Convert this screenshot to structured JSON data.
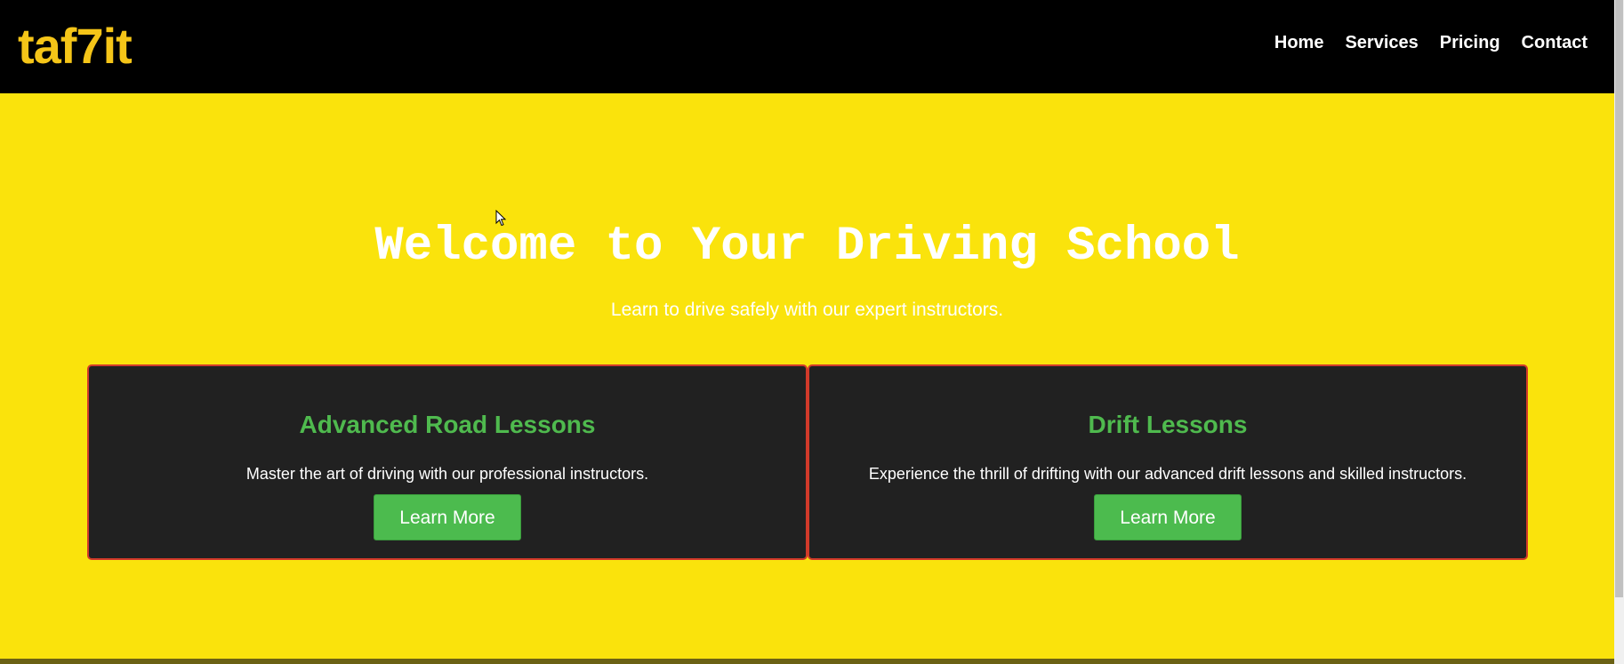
{
  "header": {
    "logo": "taf7it",
    "nav": [
      "Home",
      "Services",
      "Pricing",
      "Contact"
    ]
  },
  "hero": {
    "title": "Welcome to Your Driving School",
    "subtitle": "Learn to drive safely with our expert instructors."
  },
  "cards": [
    {
      "title": "Advanced Road Lessons",
      "text": "Master the art of driving with our professional instructors.",
      "button": "Learn More"
    },
    {
      "title": "Drift Lessons",
      "text": "Experience the thrill of drifting with our advanced drift lessons and skilled instructors.",
      "button": "Learn More"
    }
  ],
  "colors": {
    "background": "#fae30c",
    "navbar": "#000000",
    "logo": "#f5c518",
    "card_bg": "#212121",
    "card_border": "#d23a2a",
    "card_title": "#4fba4e",
    "button": "#4cbb4e"
  },
  "icons": {
    "cursor": "mouse-pointer-icon"
  }
}
